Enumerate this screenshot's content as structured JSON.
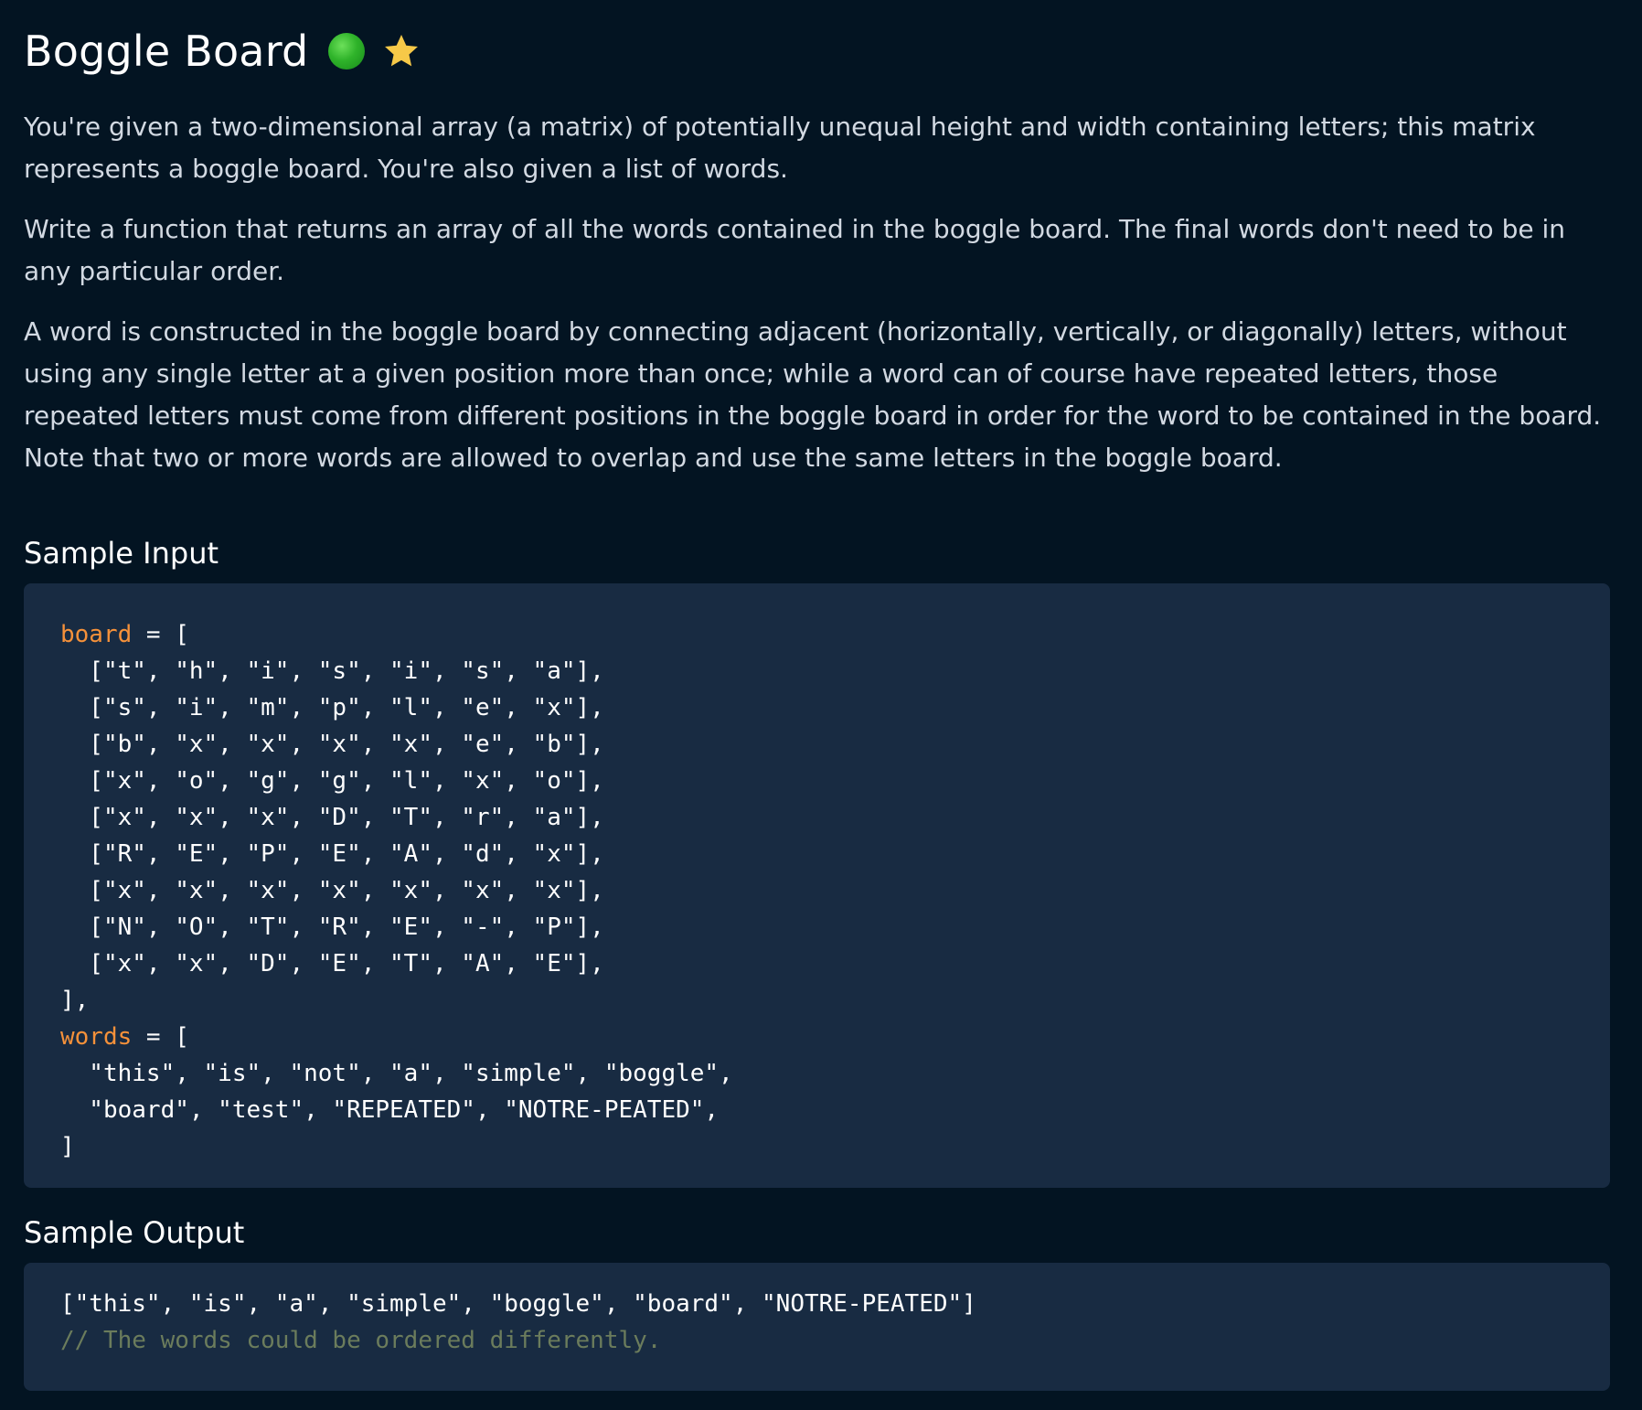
{
  "header": {
    "title": "Boggle Board",
    "difficulty_color": "#2fb32a",
    "star_color": "#f7c948"
  },
  "description": {
    "p1": "You're given a two-dimensional array (a matrix) of potentially unequal height and width containing letters; this matrix represents a boggle board. You're also given a list of words.",
    "p2": "Write a function that returns an array of all the words contained in the boggle board. The final words don't need to be in any particular order.",
    "p3": "A word is constructed in the boggle board by connecting adjacent (horizontally, vertically, or diagonally) letters, without using any single letter at a given position more than once; while a word can of course have repeated letters, those repeated letters must come from different positions in the boggle board in order for the word to be contained in the board. Note that two or more words are allowed to overlap and use the same letters in the boggle board."
  },
  "sample_input": {
    "heading": "Sample Input",
    "board_var": "board",
    "board_open": " = [",
    "board_rows": [
      "  [\"t\", \"h\", \"i\", \"s\", \"i\", \"s\", \"a\"],",
      "  [\"s\", \"i\", \"m\", \"p\", \"l\", \"e\", \"x\"],",
      "  [\"b\", \"x\", \"x\", \"x\", \"x\", \"e\", \"b\"],",
      "  [\"x\", \"o\", \"g\", \"g\", \"l\", \"x\", \"o\"],",
      "  [\"x\", \"x\", \"x\", \"D\", \"T\", \"r\", \"a\"],",
      "  [\"R\", \"E\", \"P\", \"E\", \"A\", \"d\", \"x\"],",
      "  [\"x\", \"x\", \"x\", \"x\", \"x\", \"x\", \"x\"],",
      "  [\"N\", \"O\", \"T\", \"R\", \"E\", \"-\", \"P\"],",
      "  [\"x\", \"x\", \"D\", \"E\", \"T\", \"A\", \"E\"],"
    ],
    "board_close": "],",
    "words_var": "words",
    "words_open": " = [",
    "words_rows": [
      "  \"this\", \"is\", \"not\", \"a\", \"simple\", \"boggle\",",
      "  \"board\", \"test\", \"REPEATED\", \"NOTRE-PEATED\","
    ],
    "words_close": "]"
  },
  "sample_output": {
    "heading": "Sample Output",
    "result": "[\"this\", \"is\", \"a\", \"simple\", \"boggle\", \"board\", \"NOTRE-PEATED\"]",
    "comment": "// The words could be ordered differently."
  }
}
